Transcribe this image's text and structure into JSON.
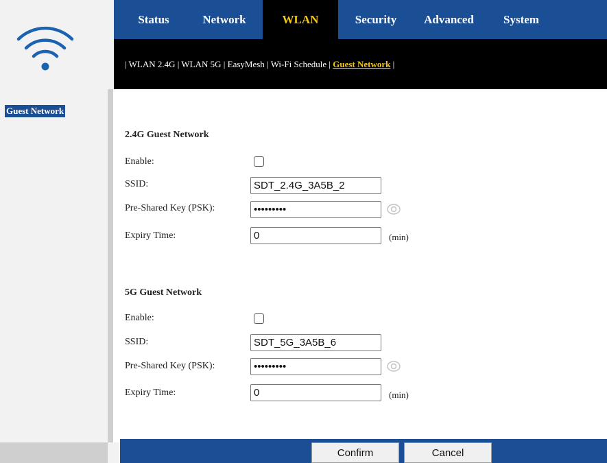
{
  "nav": {
    "tabs": [
      {
        "label": "Status"
      },
      {
        "label": "Network"
      },
      {
        "label": "WLAN"
      },
      {
        "label": "Security"
      },
      {
        "label": "Advanced"
      },
      {
        "label": "System"
      }
    ],
    "active_tab": "WLAN"
  },
  "subnav": {
    "items": [
      {
        "label": "WLAN 2.4G"
      },
      {
        "label": "WLAN 5G"
      },
      {
        "label": "EasyMesh"
      },
      {
        "label": "Wi-Fi Schedule"
      },
      {
        "label": "Guest Network"
      }
    ],
    "separator": "|",
    "active": "Guest Network"
  },
  "sidebar": {
    "items": [
      {
        "label": "Guest Network"
      }
    ]
  },
  "guest_24g": {
    "title": "2.4G Guest Network",
    "enable_label": "Enable:",
    "enabled": false,
    "ssid_label": "SSID:",
    "ssid_value": "SDT_2.4G_3A5B_2",
    "psk_label": "Pre-Shared Key (PSK):",
    "psk_value": "•••••••••",
    "expiry_label": "Expiry Time:",
    "expiry_value": "0",
    "expiry_unit": "(min)"
  },
  "guest_5g": {
    "title": "5G Guest Network",
    "enable_label": "Enable:",
    "enabled": false,
    "ssid_label": "SSID:",
    "ssid_value": "SDT_5G_3A5B_6",
    "psk_label": "Pre-Shared Key (PSK):",
    "psk_value": "•••••••••",
    "expiry_label": "Expiry Time:",
    "expiry_value": "0",
    "expiry_unit": "(min)"
  },
  "footer": {
    "confirm_label": "Confirm",
    "cancel_label": "Cancel"
  },
  "colors": {
    "nav_blue": "#1a4f95",
    "active_yellow": "#f3c61c",
    "logo_blue": "#1b62b1"
  },
  "icons": {
    "logo": "wifi-icon",
    "password_toggle": "eye-icon"
  }
}
